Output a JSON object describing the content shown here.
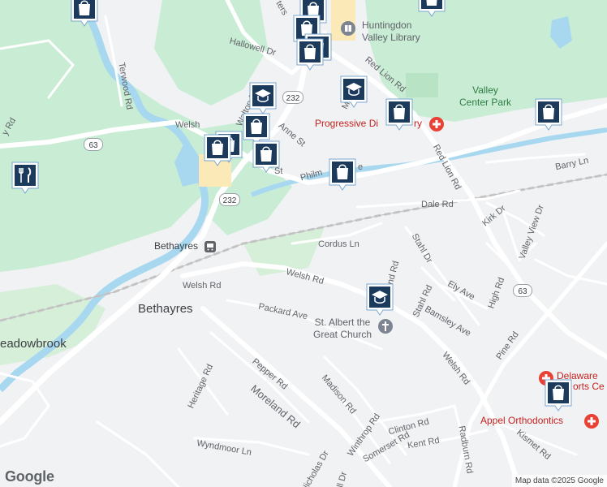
{
  "map": {
    "towns": {
      "bethayres": "Bethayres",
      "meadowbrook": "eadowbrook"
    },
    "places": {
      "library": "Huntingdon Valley Library",
      "park": "Valley Center Park",
      "progressive": "Progressive Di",
      "progressive_end": "ry",
      "station": "Bethayres",
      "church": "St. Albert the Great Church",
      "delaware": "Delaware",
      "delaware2": "orts Ce",
      "appel": "Appel Orthodontics"
    },
    "roads": {
      "welsh_w": "Welsh",
      "welsh_mid": "Welsh Rd",
      "welsh_main": "Welsh Rd",
      "welsh_se": "Welsh Rd",
      "red_lion": "Red Lion Rd",
      "red_lion_n": "Red Lion Rd",
      "philm": "Philm",
      "philm2": "e",
      "hallowell": "Hallowell Dr",
      "terwood": "Terwood Rd",
      "dale": "Dale Rd",
      "cordus": "Cordus Ln",
      "barry": "Barry Ln",
      "kirk": "Kirk Dr",
      "valley_view": "Valley View Dr",
      "stahl_dr": "Stahl Dr",
      "stahl_rd": "Stahl Rd",
      "ely": "Ely Ave",
      "high": "High Rd",
      "bamsley": "Bamsley Ave",
      "pine": "Pine Rd",
      "packard": "Packard Ave",
      "pepper": "Pepper Rd",
      "heritage": "Heritage Rd",
      "moreland": "Moreland Rd",
      "madison": "Madison Rd",
      "winthrop": "Winthrop Rd",
      "somerset": "Somerset Rd",
      "clinton": "Clinton Rd",
      "kent": "Kent Rd",
      "radburn": "Radburn Rd",
      "kismet": "Kismet Rd",
      "wyndmoor": "Wyndmoor Ln",
      "nicholas": "Nicholas Dr",
      "anne": "Anne St",
      "walton": "Walton Rd",
      "murray": "Murray A",
      "st": "St",
      "ters": "ters",
      "nd_rd": "nd Rd",
      "y_rd": "y Rd",
      "ll_dr": "ll Dr"
    },
    "shields": {
      "r63a": "63",
      "r63b": "63",
      "r232a": "232",
      "r232b": "232"
    },
    "icons": {
      "shopping": "shopping-bag-icon",
      "school": "graduation-cap-icon",
      "restaurant": "fork-knife-icon",
      "hospital": "cross-icon",
      "church": "church-cross-icon",
      "library": "book-icon",
      "train": "train-icon"
    },
    "colors": {
      "land": "#f1f2f4",
      "park": "#c8ecd4",
      "water": "#a7d8f0",
      "road": "#ffffff",
      "pin": "#1b3a5c",
      "hospital": "#e94235"
    },
    "attribution": "Map data ©2025 Google",
    "logo": "Google"
  }
}
